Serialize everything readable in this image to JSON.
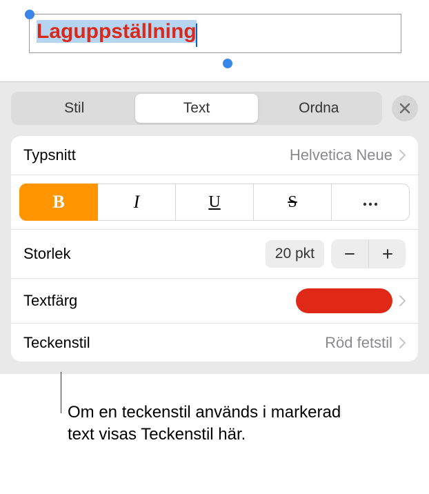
{
  "textBox": {
    "content": "Laguppställning"
  },
  "tabs": {
    "style": "Stil",
    "text": "Text",
    "arrange": "Ordna"
  },
  "font": {
    "label": "Typsnitt",
    "value": "Helvetica Neue"
  },
  "styleButtons": {
    "bold": "B",
    "italic": "I",
    "underline": "U",
    "strike": "S"
  },
  "size": {
    "label": "Storlek",
    "value": "20 pkt"
  },
  "textColor": {
    "label": "Textfärg",
    "value": "#e02817"
  },
  "charStyle": {
    "label": "Teckenstil",
    "value": "Röd fetstil"
  },
  "callout": "Om en teckenstil används i markerad text visas Teckenstil här."
}
